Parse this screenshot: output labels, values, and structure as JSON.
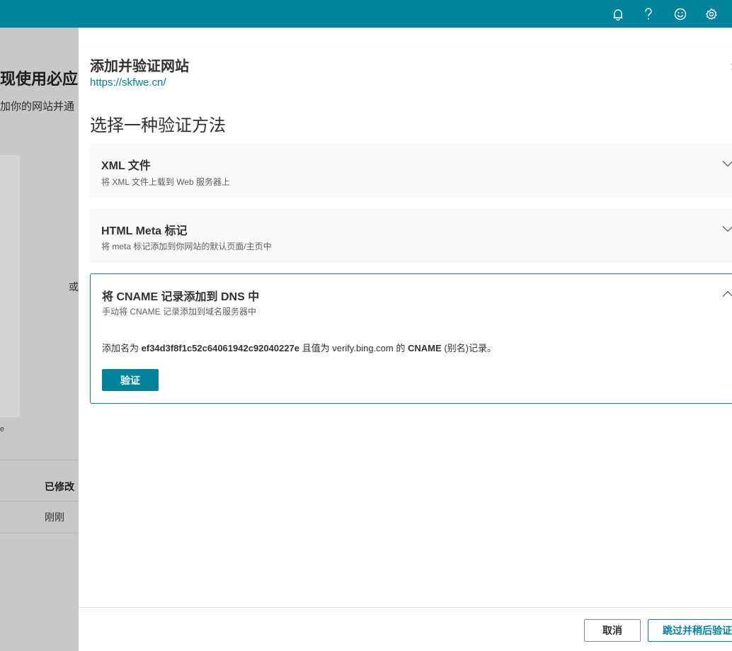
{
  "topbar": {
    "icons": [
      "bell-icon",
      "help-icon",
      "smiley-icon",
      "gear-icon"
    ],
    "color": "#00839b"
  },
  "background_page": {
    "title_fragment": "现使用必应网",
    "subtitle_fragment": "加你的网站并通",
    "or_text": "或",
    "e_text": "e",
    "column_modified": "已修改",
    "row_modified": "刚刚"
  },
  "panel": {
    "title": "添加并验证网站",
    "site_url": "https://skfwe.cn/",
    "section_title": "选择一种验证方法",
    "methods": [
      {
        "title": "XML 文件",
        "description": "将 XML 文件上载到 Web 服务器上",
        "expanded": false
      },
      {
        "title": "HTML Meta 标记",
        "description": "将 meta 标记添加到你网站的默认页面/主页中",
        "expanded": false
      },
      {
        "title": "将 CNAME 记录添加到 DNS 中",
        "description": "手动将 CNAME 记录添加到域名服务器中",
        "expanded": true,
        "instruction_prefix": "添加名为",
        "cname_name": "ef34d3f8f1c52c64061942c92040227e",
        "instruction_middle": "且值为",
        "cname_value": "verify.bing.com",
        "instruction_of": "的",
        "cname_type": "CNAME",
        "instruction_suffix": "(别名)记录。",
        "verify_button": "验证"
      }
    ],
    "cancel_button": "取消",
    "skip_button": "跳过并稍后验证"
  },
  "colors": {
    "accent": "#00839b",
    "method_bg": "#faf9f8",
    "overlay": "#c8c8c8"
  }
}
